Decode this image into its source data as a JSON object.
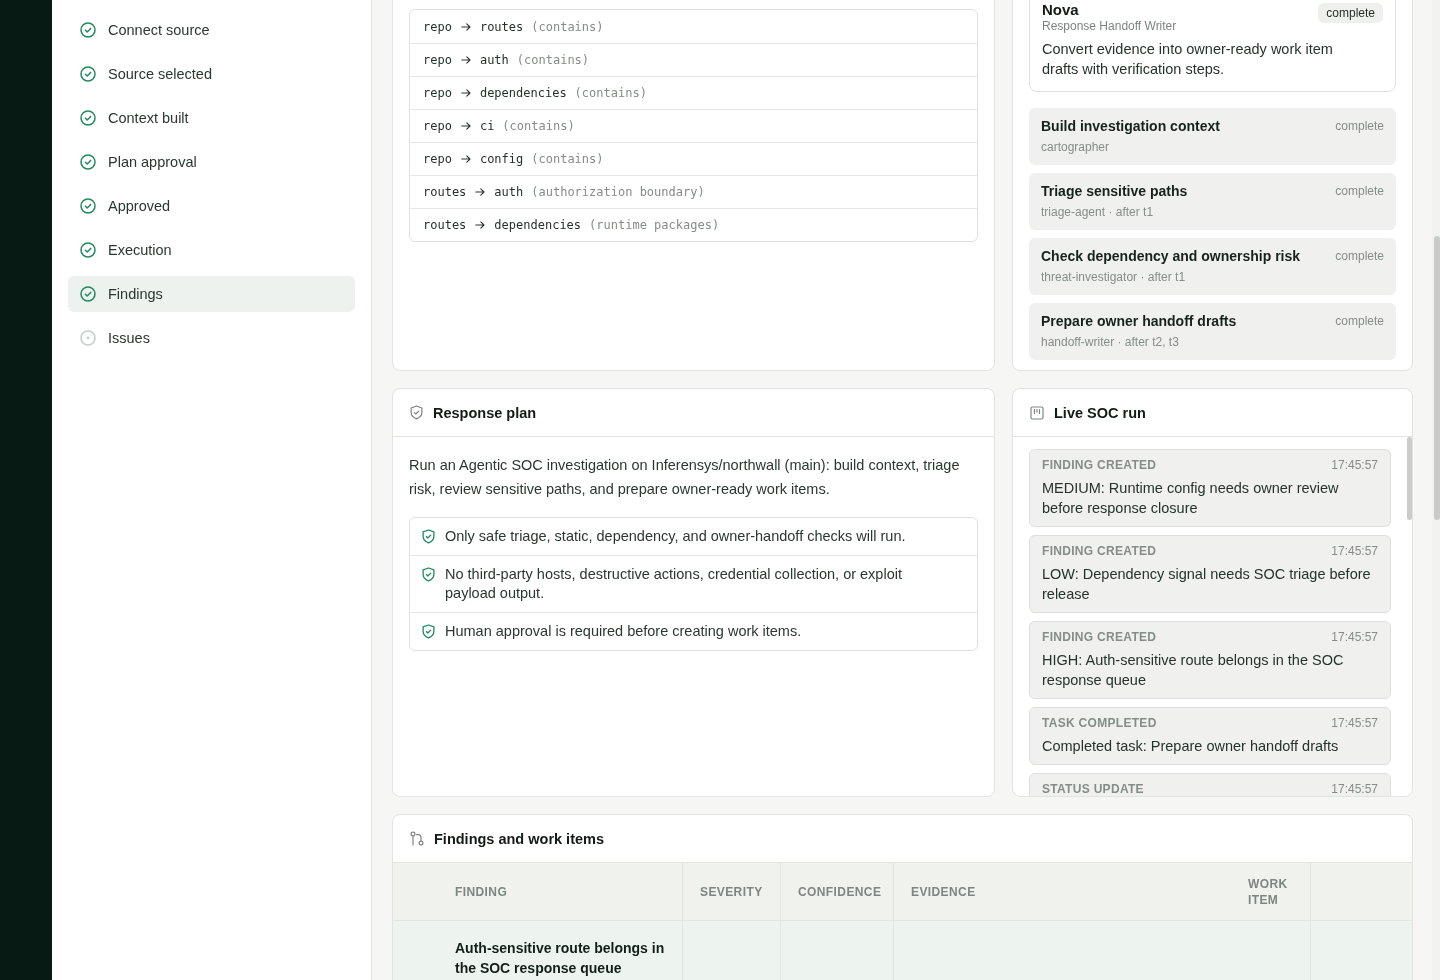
{
  "steps": [
    {
      "label": "Connect source",
      "done": true,
      "selected": false
    },
    {
      "label": "Source selected",
      "done": true,
      "selected": false
    },
    {
      "label": "Context built",
      "done": true,
      "selected": false
    },
    {
      "label": "Plan approval",
      "done": true,
      "selected": false
    },
    {
      "label": "Approved",
      "done": true,
      "selected": false
    },
    {
      "label": "Execution",
      "done": true,
      "selected": false
    },
    {
      "label": "Findings",
      "done": true,
      "selected": true
    },
    {
      "label": "Issues",
      "done": false,
      "selected": false
    }
  ],
  "graph_edges": [
    {
      "from": "repo",
      "to": "routes",
      "relation": "(contains)"
    },
    {
      "from": "repo",
      "to": "auth",
      "relation": "(contains)"
    },
    {
      "from": "repo",
      "to": "dependencies",
      "relation": "(contains)"
    },
    {
      "from": "repo",
      "to": "ci",
      "relation": "(contains)"
    },
    {
      "from": "repo",
      "to": "config",
      "relation": "(contains)"
    },
    {
      "from": "routes",
      "to": "auth",
      "relation": "(authorization boundary)"
    },
    {
      "from": "routes",
      "to": "dependencies",
      "relation": "(runtime packages)"
    }
  ],
  "agent": {
    "name": "Nova",
    "role": "Response Handoff Writer",
    "status": "complete",
    "description": "Convert evidence into owner-ready work item drafts with verification steps."
  },
  "tasks": [
    {
      "title": "Build investigation context",
      "status": "complete",
      "meta": "cartographer"
    },
    {
      "title": "Triage sensitive paths",
      "status": "complete",
      "meta": "triage-agent · after t1"
    },
    {
      "title": "Check dependency and ownership risk",
      "status": "complete",
      "meta": "threat-investigator · after t1"
    },
    {
      "title": "Prepare owner handoff drafts",
      "status": "complete",
      "meta": "handoff-writer · after t2, t3"
    }
  ],
  "response_plan": {
    "title": "Response plan",
    "summary": "Run an Agentic SOC investigation on Inferensys/northwall (main): build context, triage risk, review sensitive paths, and prepare owner-ready work items.",
    "guardrails": [
      "Only safe triage, static, dependency, and owner-handoff checks will run.",
      "No third-party hosts, destructive actions, credential collection, or exploit payload output.",
      "Human approval is required before creating work items."
    ]
  },
  "live_run": {
    "title": "Live SOC run",
    "events": [
      {
        "type": "FINDING CREATED",
        "time": "17:45:57",
        "message": "MEDIUM: Runtime config needs owner review before response closure"
      },
      {
        "type": "FINDING CREATED",
        "time": "17:45:57",
        "message": "LOW: Dependency signal needs SOC triage before release"
      },
      {
        "type": "FINDING CREATED",
        "time": "17:45:57",
        "message": "HIGH: Auth-sensitive route belongs in the SOC response queue"
      },
      {
        "type": "TASK COMPLETED",
        "time": "17:45:57",
        "message": "Completed task: Prepare owner handoff drafts"
      },
      {
        "type": "STATUS UPDATE",
        "time": "17:45:57"
      }
    ]
  },
  "findings": {
    "title": "Findings and work items",
    "columns": [
      "FINDING",
      "SEVERITY",
      "CONFIDENCE",
      "EVIDENCE",
      "WORK ITEM"
    ],
    "rows": [
      {
        "finding": "Auth-sensitive route belongs in the SOC response queue",
        "selected": true
      }
    ]
  }
}
